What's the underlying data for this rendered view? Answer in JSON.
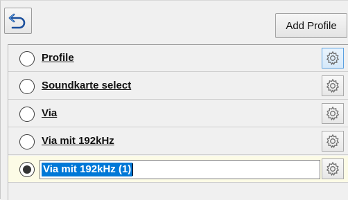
{
  "toolbar": {
    "back_icon": "undo-arrow-icon",
    "add_profile_label": "Add Profile"
  },
  "profiles": [
    {
      "name": "Profile",
      "checked": false,
      "editing": false
    },
    {
      "name": "Soundkarte select",
      "checked": false,
      "editing": false
    },
    {
      "name": "Via",
      "checked": false,
      "editing": false
    },
    {
      "name": "Via mit 192kHz",
      "checked": false,
      "editing": false
    },
    {
      "name": "Via mit 192kHz (1)",
      "checked": true,
      "editing": true
    }
  ],
  "colors": {
    "selection": "#0078d7",
    "editing_row_bg": "#fcfbe6"
  }
}
